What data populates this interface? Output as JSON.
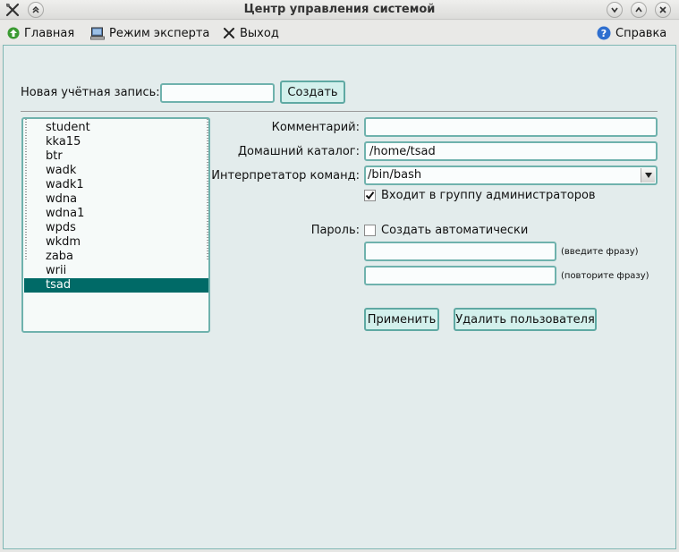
{
  "window": {
    "title": "Центр управления системой"
  },
  "menu": {
    "home": "Главная",
    "expert": "Режим эксперта",
    "exit": "Выход",
    "help": "Справка"
  },
  "new_account": {
    "label": "Новая учётная запись:",
    "value": "",
    "create_button": "Создать"
  },
  "users": {
    "items": [
      "student",
      "kka15",
      "btr",
      "wadk",
      "wadk1",
      "wdna",
      "wdna1",
      "wpds",
      "wkdm",
      "zaba",
      "wrii",
      "tsad"
    ],
    "selected": "tsad"
  },
  "form": {
    "comment_label": "Комментарий:",
    "comment_value": "",
    "home_label": "Домашний каталог:",
    "home_value": "/home/tsad",
    "shell_label": "Интерпретатор команд:",
    "shell_value": "/bin/bash",
    "admin_checkbox_label": "Входит в группу администраторов",
    "admin_checked": true,
    "password_label": "Пароль:",
    "auto_password_label": "Создать автоматически",
    "auto_password_checked": false,
    "password1_hint": "(введите фразу)",
    "password2_hint": "(повторите фразу)",
    "apply_button": "Применить",
    "delete_button": "Удалить пользователя"
  },
  "colors": {
    "accent": "#5fa9a3",
    "selection": "#006a67",
    "panel": "#e3ecec"
  }
}
